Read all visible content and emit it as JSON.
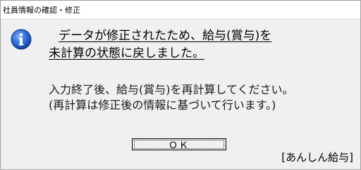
{
  "window": {
    "title": "社員情報の確認・修正"
  },
  "dialog": {
    "icon": "info-icon",
    "headline_line1": "データが修正されたため、給与(賞与)を",
    "headline_line2": "未計算の状態に戻しました。",
    "message_line1": "入力終了後、給与(賞与)を再計算してください。",
    "message_line2": "(再計算は修正後の情報に基づいて行います。)",
    "ok_label": "ＯＫ"
  },
  "footer": {
    "app_label": "[あんしん給与]"
  },
  "colors": {
    "icon_blue": "#1f5fc8",
    "background": "#f0f0f0"
  }
}
